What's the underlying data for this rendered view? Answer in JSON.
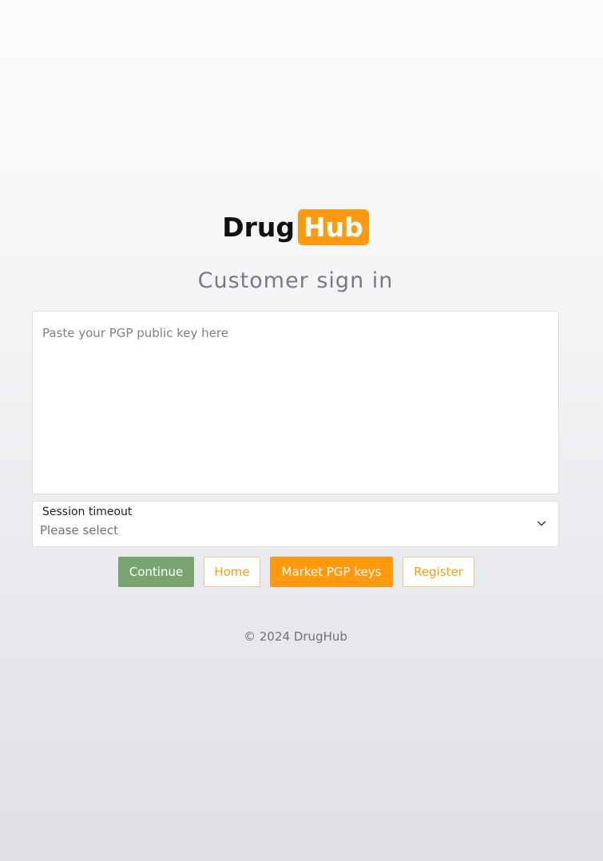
{
  "logo": {
    "part1": "Drug",
    "part2": "Hub"
  },
  "page_title": "Customer sign in",
  "pgp_input": {
    "placeholder": "Paste your PGP public key here",
    "value": ""
  },
  "session_timeout": {
    "label": "Session timeout",
    "selected": "Please select"
  },
  "buttons": {
    "continue": "Continue",
    "home": "Home",
    "market_pgp_keys": "Market PGP keys",
    "register": "Register"
  },
  "footer": {
    "copyright": "© 2024 DrugHub"
  },
  "icons": {
    "select_arrow": "chevron-down-icon"
  },
  "colors": {
    "accent_orange": "#ff9a0f",
    "continue_green": "#79a471",
    "text_gray": "#777a7e"
  }
}
